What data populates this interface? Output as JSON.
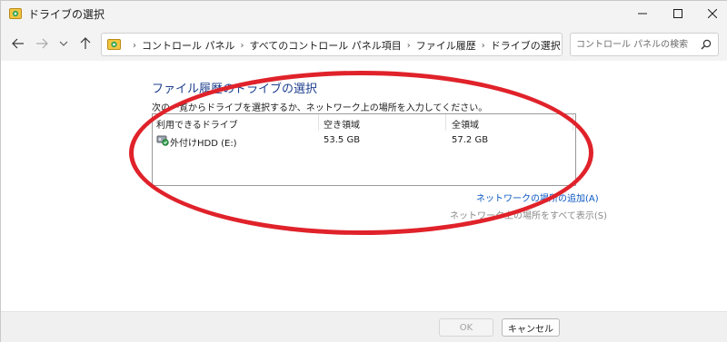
{
  "window": {
    "title": "ドライブの選択",
    "icon": "control-panel-icon"
  },
  "controls": {
    "minimize": "minimize-icon",
    "maximize": "maximize-icon",
    "close": "close-icon"
  },
  "nav": {
    "back": "back-arrow-icon",
    "forward": "forward-arrow-icon",
    "recent": "chevron-down-icon",
    "up": "up-arrow-icon"
  },
  "address": {
    "crumbs": [
      "コントロール パネル",
      "すべてのコントロール パネル項目",
      "ファイル履歴",
      "ドライブの選択"
    ]
  },
  "search": {
    "placeholder": "コントロール パネルの検索"
  },
  "main": {
    "heading": "ファイル履歴のドライブの選択",
    "instruction": "次の一覧からドライブを選択するか、ネットワーク上の場所を入力してください。",
    "columns": [
      "利用できるドライブ",
      "空き領域",
      "全領域"
    ],
    "drives": [
      {
        "name": "外付けHDD (E:)",
        "free": "53.5 GB",
        "total": "57.2 GB"
      }
    ],
    "link_add": "ネットワークの場所の追加(A)",
    "link_show": "ネットワーク上の場所をすべて表示(S)"
  },
  "footer": {
    "ok": "OK",
    "cancel": "キャンセル"
  },
  "colors": {
    "annotation": "#e0222a",
    "heading": "#1e3f8e",
    "link": "#0b57c2"
  }
}
